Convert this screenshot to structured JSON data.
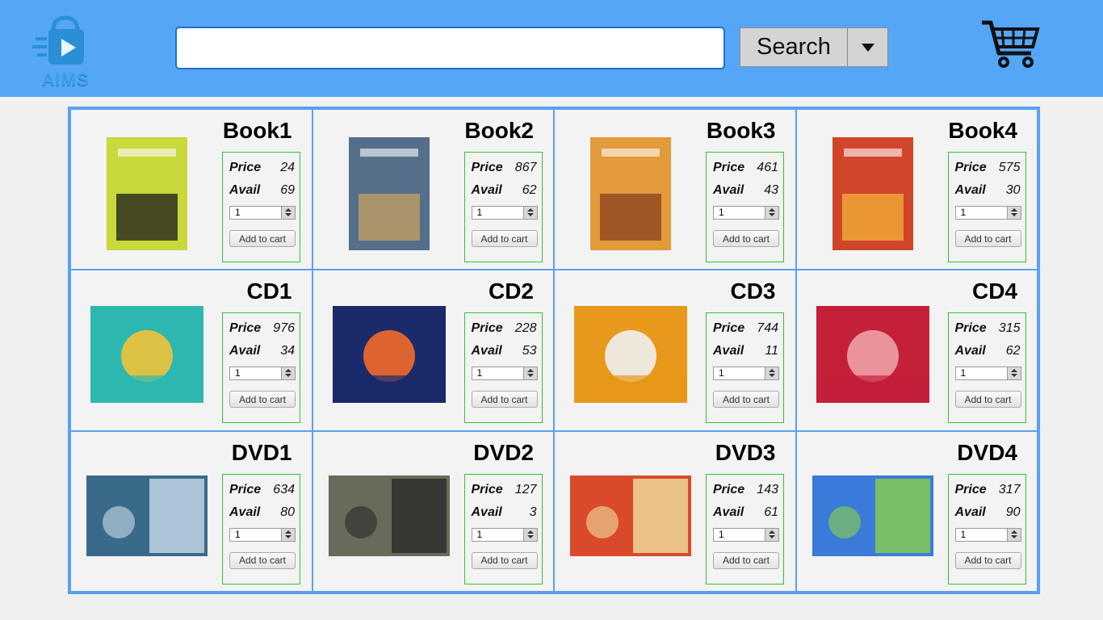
{
  "app": {
    "logo_text": "AIMS"
  },
  "search": {
    "value": "",
    "button_label": "Search"
  },
  "products": [
    {
      "title": "Book1",
      "price": "24",
      "avail": "69",
      "qty": "1",
      "cover": "book-brain",
      "colors": [
        "#c9d83a",
        "#1a1a1a"
      ]
    },
    {
      "title": "Book2",
      "price": "867",
      "avail": "62",
      "qty": "1",
      "cover": "book-remi",
      "colors": [
        "#556e8a",
        "#c8a060"
      ]
    },
    {
      "title": "Book3",
      "price": "461",
      "avail": "43",
      "qty": "1",
      "cover": "book-potter",
      "colors": [
        "#e29a3a",
        "#8a3d1e"
      ]
    },
    {
      "title": "Book4",
      "price": "575",
      "avail": "30",
      "qty": "1",
      "cover": "book-galaxy",
      "colors": [
        "#d1452a",
        "#f3b23a"
      ]
    },
    {
      "title": "CD1",
      "price": "976",
      "avail": "34",
      "qty": "1",
      "cover": "cd-vinyl",
      "colors": [
        "#2cb8b0",
        "#f0c23a"
      ]
    },
    {
      "title": "CD2",
      "price": "228",
      "avail": "53",
      "qty": "1",
      "cover": "cd-sunset",
      "colors": [
        "#1a2a6a",
        "#f36a2a"
      ]
    },
    {
      "title": "CD3",
      "price": "744",
      "avail": "11",
      "qty": "1",
      "cover": "cd-orange",
      "colors": [
        "#e8981a",
        "#f0f0f0"
      ]
    },
    {
      "title": "CD4",
      "price": "315",
      "avail": "62",
      "qty": "1",
      "cover": "cd-cheapgirls",
      "colors": [
        "#c4203a",
        "#f0a0a8"
      ]
    },
    {
      "title": "DVD1",
      "price": "634",
      "avail": "80",
      "qty": "1",
      "cover": "dvd-rogue",
      "colors": [
        "#3a6a8a",
        "#c8dce8"
      ]
    },
    {
      "title": "DVD2",
      "price": "127",
      "avail": "3",
      "qty": "1",
      "cover": "dvd-1917",
      "colors": [
        "#6a6a5a",
        "#2a2a2a"
      ]
    },
    {
      "title": "DVD3",
      "price": "143",
      "avail": "61",
      "qty": "1",
      "cover": "dvd-homealone",
      "colors": [
        "#d84a2a",
        "#f0e0a0"
      ]
    },
    {
      "title": "DVD4",
      "price": "317",
      "avail": "90",
      "qty": "1",
      "cover": "dvd-hotel",
      "colors": [
        "#3a7ad8",
        "#8ad04a"
      ]
    }
  ],
  "labels": {
    "price": "Price",
    "avail": "Avail",
    "add_to_cart": "Add to cart"
  }
}
